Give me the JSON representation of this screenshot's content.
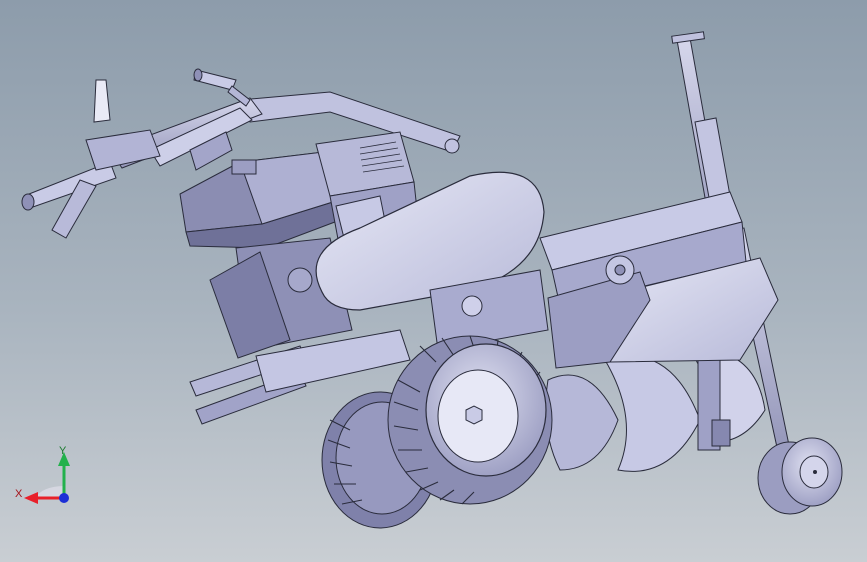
{
  "triad": {
    "x_label": "X",
    "y_label": "Y",
    "x_color": "#e8202a",
    "y_color": "#22b14c",
    "z_color": "#1c2fd6"
  },
  "colors": {
    "part_fill": "#c9cbe6",
    "part_light": "#e3e4f4",
    "part_dark": "#7d80a6",
    "edge": "#2a2c3c"
  }
}
